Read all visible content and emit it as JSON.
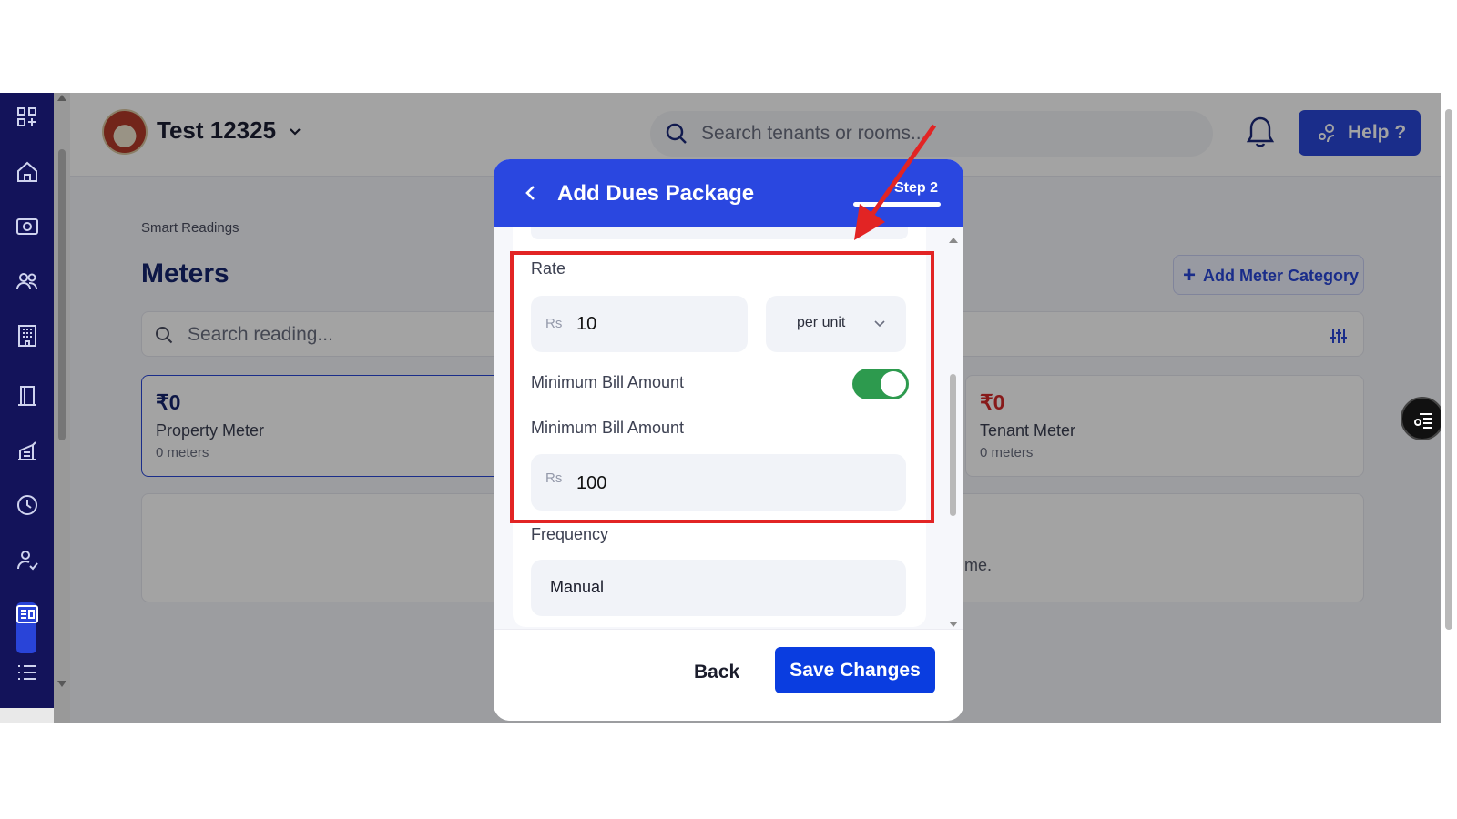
{
  "app": {
    "property_name": "Test 12325",
    "search_placeholder": "Search tenants or rooms...",
    "help_label": "Help ?"
  },
  "sidebar": {
    "items": [
      "grid-icon",
      "home-icon",
      "camera-icon",
      "users-icon",
      "building-icon",
      "door-icon",
      "receipt-icon",
      "clock-icon",
      "user-check-icon",
      "meter-icon",
      "list-icon"
    ],
    "active_item": "meter-icon"
  },
  "page": {
    "breadcrumb": "Smart Readings",
    "title": "Meters",
    "add_category_label": "Add Meter Category",
    "reading_search_placeholder": "Search reading...",
    "empty_text_fragment": "me."
  },
  "meter_cards": [
    {
      "amount": "₹0",
      "name": "Property Meter",
      "count": "0 meters",
      "amount_color": "#15256e"
    },
    {
      "amount": "₹0",
      "name": "Tenant Meter",
      "count": "0 meters",
      "amount_color": "#d42a2a"
    }
  ],
  "modal": {
    "title": "Add Dues Package",
    "step": "Step 2",
    "rate_label": "Rate",
    "rate_prefix": "Rs",
    "rate_value": "10",
    "unit_value": "per unit",
    "min_bill_toggle_label": "Minimum Bill Amount",
    "min_bill_toggle_on": true,
    "min_bill_label": "Minimum Bill Amount",
    "min_bill_prefix": "Rs",
    "min_bill_value": "100",
    "frequency_label": "Frequency",
    "frequency_value": "Manual",
    "back_label": "Back",
    "save_label": "Save Changes"
  },
  "colors": {
    "sidebar": "#13135a",
    "accent": "#2a47d8",
    "toggle_on": "#2d9a4e",
    "annotation": "#e22424"
  }
}
